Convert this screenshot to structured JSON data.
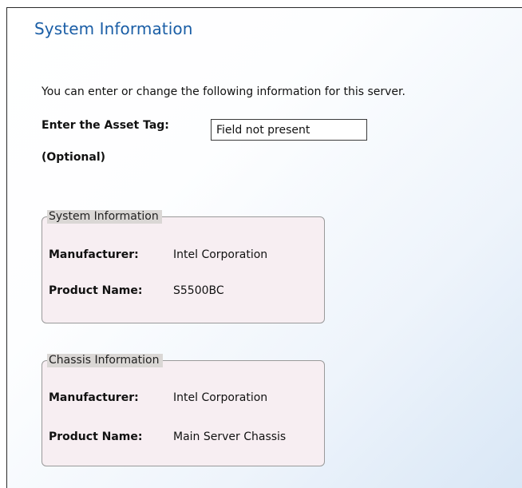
{
  "page": {
    "title": "System Information",
    "intro": "You can enter or change the following information for this server."
  },
  "asset_tag": {
    "label": "Enter the Asset Tag:",
    "optional": "(Optional)",
    "value": "Field not present"
  },
  "system_info": {
    "legend": "System Information",
    "manufacturer_label": "Manufacturer:",
    "manufacturer_value": "Intel Corporation",
    "product_label": "Product Name:",
    "product_value": "S5500BC"
  },
  "chassis_info": {
    "legend": "Chassis Information",
    "manufacturer_label": "Manufacturer:",
    "manufacturer_value": "Intel Corporation",
    "product_label": "Product Name:",
    "product_value": "Main Server Chassis"
  }
}
